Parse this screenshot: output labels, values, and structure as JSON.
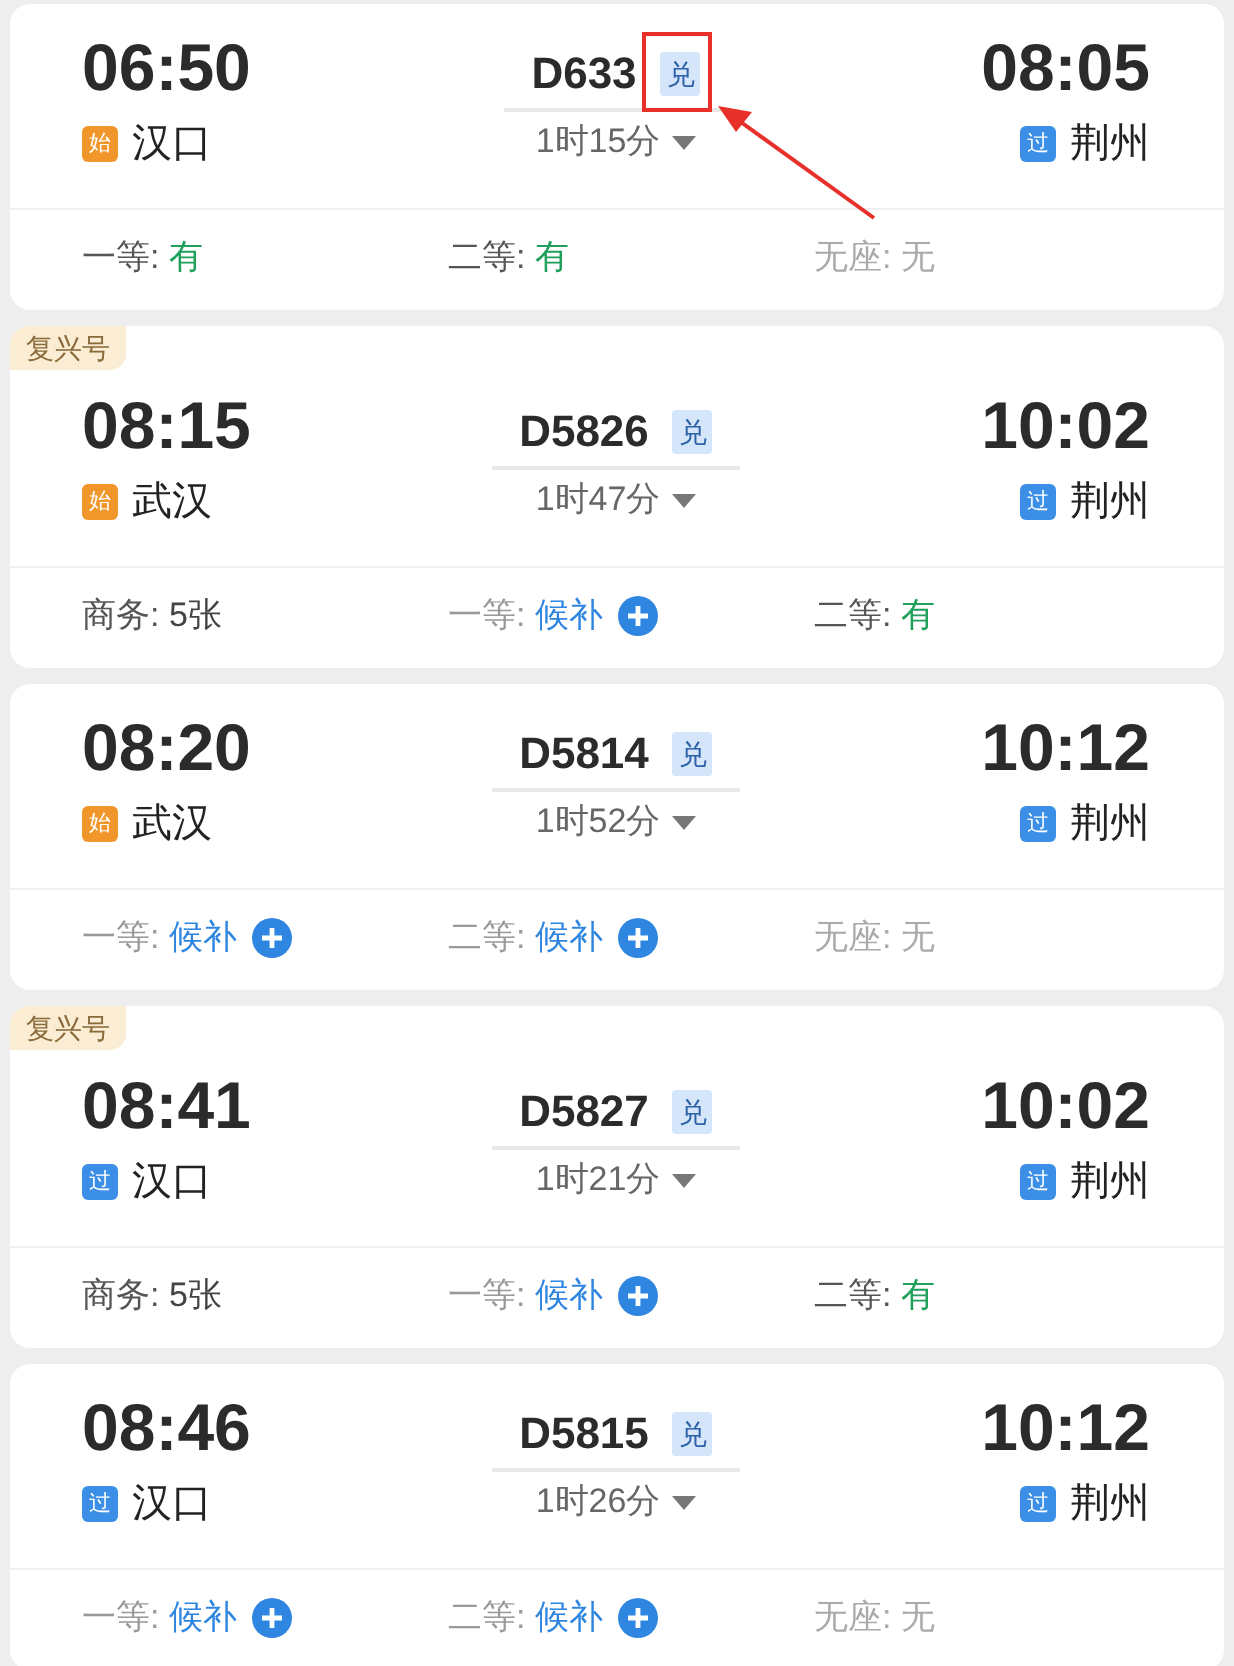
{
  "trains": [
    {
      "depart_time": "06:50",
      "depart_station": {
        "badge": "始",
        "kind": "start",
        "name": "汉口"
      },
      "train_no": "D633",
      "exchange_badge": "兑",
      "highlighted": true,
      "duration": "1时15分",
      "arrive_time": "08:05",
      "arrive_station": {
        "badge": "过",
        "kind": "pass",
        "name": "荆州"
      },
      "seats": [
        {
          "label": "一等:",
          "value": "有",
          "kind": "available"
        },
        {
          "label": "二等:",
          "value": "有",
          "kind": "available"
        },
        {
          "label": "无座:",
          "value": "无",
          "kind": "none"
        }
      ]
    },
    {
      "tag": "复兴号",
      "depart_time": "08:15",
      "depart_station": {
        "badge": "始",
        "kind": "start",
        "name": "武汉"
      },
      "train_no": "D5826",
      "exchange_badge": "兑",
      "highlighted": false,
      "duration": "1时47分",
      "arrive_time": "10:02",
      "arrive_station": {
        "badge": "过",
        "kind": "pass",
        "name": "荆州"
      },
      "seats": [
        {
          "label": "商务:",
          "value": "5张",
          "kind": "count"
        },
        {
          "label": "一等:",
          "value": "候补",
          "kind": "waitlist"
        },
        {
          "label": "二等:",
          "value": "有",
          "kind": "available"
        }
      ]
    },
    {
      "depart_time": "08:20",
      "depart_station": {
        "badge": "始",
        "kind": "start",
        "name": "武汉"
      },
      "train_no": "D5814",
      "exchange_badge": "兑",
      "highlighted": false,
      "duration": "1时52分",
      "arrive_time": "10:12",
      "arrive_station": {
        "badge": "过",
        "kind": "pass",
        "name": "荆州"
      },
      "seats": [
        {
          "label": "一等:",
          "value": "候补",
          "kind": "waitlist"
        },
        {
          "label": "二等:",
          "value": "候补",
          "kind": "waitlist"
        },
        {
          "label": "无座:",
          "value": "无",
          "kind": "none"
        }
      ]
    },
    {
      "tag": "复兴号",
      "depart_time": "08:41",
      "depart_station": {
        "badge": "过",
        "kind": "pass",
        "name": "汉口"
      },
      "train_no": "D5827",
      "exchange_badge": "兑",
      "highlighted": false,
      "duration": "1时21分",
      "arrive_time": "10:02",
      "arrive_station": {
        "badge": "过",
        "kind": "pass",
        "name": "荆州"
      },
      "seats": [
        {
          "label": "商务:",
          "value": "5张",
          "kind": "count"
        },
        {
          "label": "一等:",
          "value": "候补",
          "kind": "waitlist"
        },
        {
          "label": "二等:",
          "value": "有",
          "kind": "available"
        }
      ]
    },
    {
      "depart_time": "08:46",
      "depart_station": {
        "badge": "过",
        "kind": "pass",
        "name": "汉口"
      },
      "train_no": "D5815",
      "exchange_badge": "兑",
      "highlighted": false,
      "duration": "1时26分",
      "arrive_time": "10:12",
      "arrive_station": {
        "badge": "过",
        "kind": "pass",
        "name": "荆州"
      },
      "seats": [
        {
          "label": "一等:",
          "value": "候补",
          "kind": "waitlist"
        },
        {
          "label": "二等:",
          "value": "候补",
          "kind": "waitlist"
        },
        {
          "label": "无座:",
          "value": "无",
          "kind": "none"
        }
      ]
    }
  ]
}
